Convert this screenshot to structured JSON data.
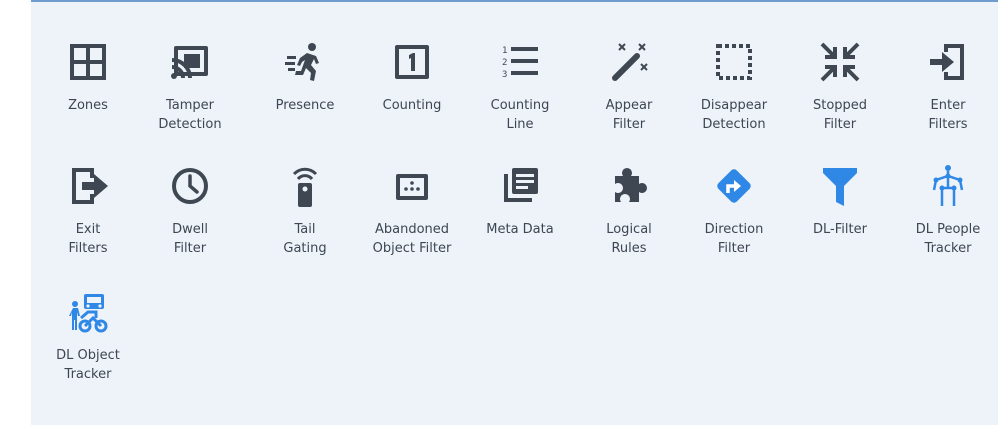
{
  "palette": {
    "dark": "#3f4852",
    "blue": "#2f87e6",
    "panel": "#eef3fa",
    "text": "#3d4651"
  },
  "filters": [
    {
      "label": "Zones",
      "icon": "zones-icon"
    },
    {
      "label": "Tamper\nDetection",
      "icon": "cast-icon"
    },
    {
      "label": "Presence",
      "icon": "running-person-icon"
    },
    {
      "label": "Counting",
      "icon": "counter-one-icon"
    },
    {
      "label": "Counting\nLine",
      "icon": "numbered-list-icon"
    },
    {
      "label": "Appear\nFilter",
      "icon": "magic-wand-icon"
    },
    {
      "label": "Disappear\nDetection",
      "icon": "dashed-square-icon"
    },
    {
      "label": "Stopped\nFilter",
      "icon": "collapse-arrows-icon"
    },
    {
      "label": "Enter\nFilters",
      "icon": "enter-icon"
    },
    {
      "label": "Exit\nFilters",
      "icon": "exit-icon"
    },
    {
      "label": "Dwell\nFilter",
      "icon": "clock-icon"
    },
    {
      "label": "Tail\nGating",
      "icon": "remote-signal-icon"
    },
    {
      "label": "Abandoned\nObject Filter",
      "icon": "keypad-box-icon"
    },
    {
      "label": "Meta Data",
      "icon": "document-stack-icon"
    },
    {
      "label": "Logical\nRules",
      "icon": "puzzle-icon"
    },
    {
      "label": "Direction\nFilter",
      "icon": "direction-sign-icon"
    },
    {
      "label": "DL-Filter",
      "icon": "funnel-icon"
    },
    {
      "label": "DL People\nTracker",
      "icon": "skeleton-figure-icon"
    },
    {
      "label": "DL Object\nTracker",
      "icon": "person-vehicle-icon"
    }
  ]
}
